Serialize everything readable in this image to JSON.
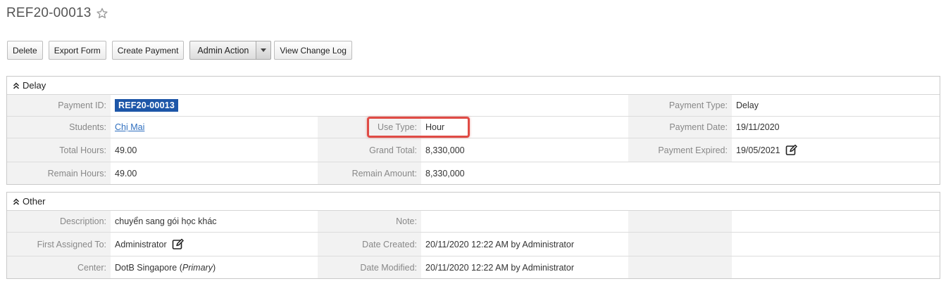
{
  "record": {
    "title": "REF20-00013",
    "favorite_icon": "star-outline-icon"
  },
  "toolbar": {
    "delete_label": "Delete",
    "export_label": "Export Form",
    "create_payment_label": "Create Payment",
    "admin_action_label": "Admin Action",
    "view_change_log_label": "View Change Log"
  },
  "delay_panel": {
    "title": "Delay",
    "payment_id_label": "Payment ID:",
    "payment_id_value": "REF20-00013",
    "payment_type_label": "Payment Type:",
    "payment_type_value": "Delay",
    "students_label": "Students:",
    "students_value": "Chị Mai",
    "use_type_label": "Use Type:",
    "use_type_value": "Hour",
    "payment_date_label": "Payment Date:",
    "payment_date_value": "19/11/2020",
    "total_hours_label": "Total Hours:",
    "total_hours_value": "49.00",
    "grand_total_label": "Grand Total:",
    "grand_total_value": "8,330,000",
    "payment_expired_label": "Payment Expired:",
    "payment_expired_value": "19/05/2021",
    "remain_hours_label": "Remain Hours:",
    "remain_hours_value": "49.00",
    "remain_amount_label": "Remain Amount:",
    "remain_amount_value": "8,330,000"
  },
  "other_panel": {
    "title": "Other",
    "description_label": "Description:",
    "description_value": "chuyển sang gói học khác",
    "note_label": "Note:",
    "note_value": "",
    "first_assigned_label": "First Assigned To:",
    "first_assigned_value": "Administrator",
    "date_created_label": "Date Created:",
    "date_created_value": "20/11/2020 12:22 AM by Administrator",
    "center_label": "Center:",
    "center_name": "DotB Singapore",
    "center_primary": "Primary",
    "date_modified_label": "Date Modified:",
    "date_modified_value": "20/11/2020 12:22 AM by Administrator"
  },
  "colors": {
    "badge": "#1d56a8",
    "link": "#2f6fbf",
    "highlight": "#e04b45",
    "label_bg": "#f2f2f2"
  }
}
